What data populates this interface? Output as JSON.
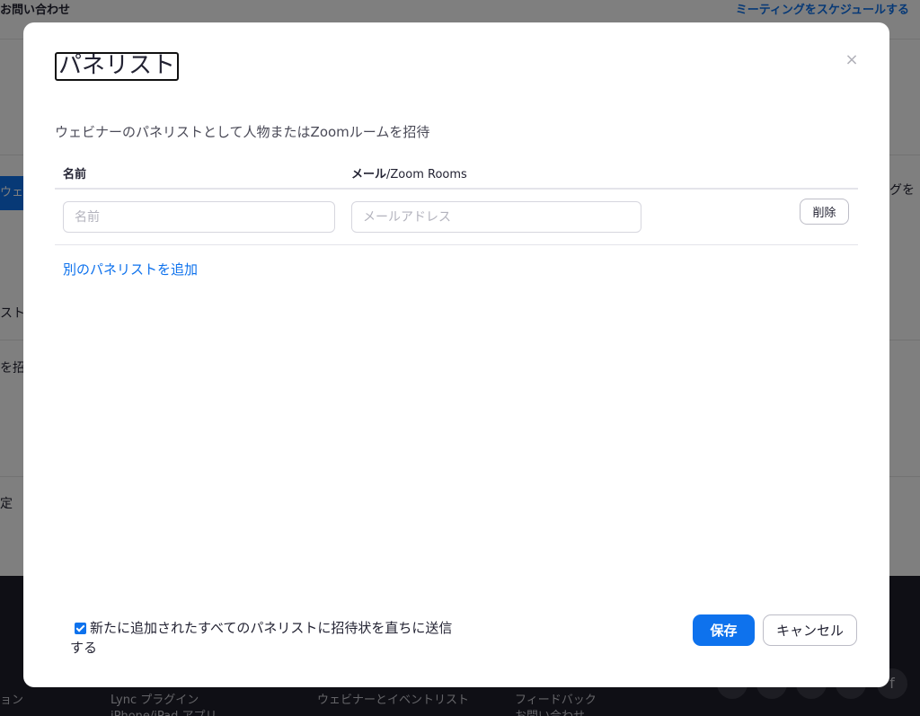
{
  "background": {
    "top_left_link": "お問い合わせ",
    "top_right_link": "ミーティングをスケジュールする",
    "left_fragments": [
      "ウェビ",
      "スト",
      "を招",
      "定"
    ],
    "right_fragment": "グを",
    "footer_items": [
      "ョン",
      "Lync プラグイン",
      "iPhone/iPad アプリ",
      "ウェビナーとイベントリスト",
      "フィードバック",
      "お問い合わせ"
    ],
    "social_icon_glyph": "f"
  },
  "modal": {
    "title": "パネリスト",
    "close_glyph": "×",
    "description": "ウェビナーのパネリストとして人物またはZoomルームを招待",
    "table": {
      "col_name": "名前",
      "col_email_main": "メール",
      "col_email_sub": "/Zoom Rooms",
      "rows": [
        {
          "name_value": "",
          "name_placeholder": "名前",
          "email_value": "",
          "email_placeholder": "メールアドレス",
          "delete_label": "削除"
        }
      ]
    },
    "add_link": "別のパネリストを追加",
    "notify_checkbox_checked": true,
    "notify_text": "新たに追加されたすべてのパネリストに招待状を直ちに送信する",
    "save_label": "保存",
    "cancel_label": "キャンセル"
  },
  "colors": {
    "accent": "#0e72ed",
    "overlay": "rgba(0,0,0,0.5)",
    "footer": "#1f1f2a"
  }
}
